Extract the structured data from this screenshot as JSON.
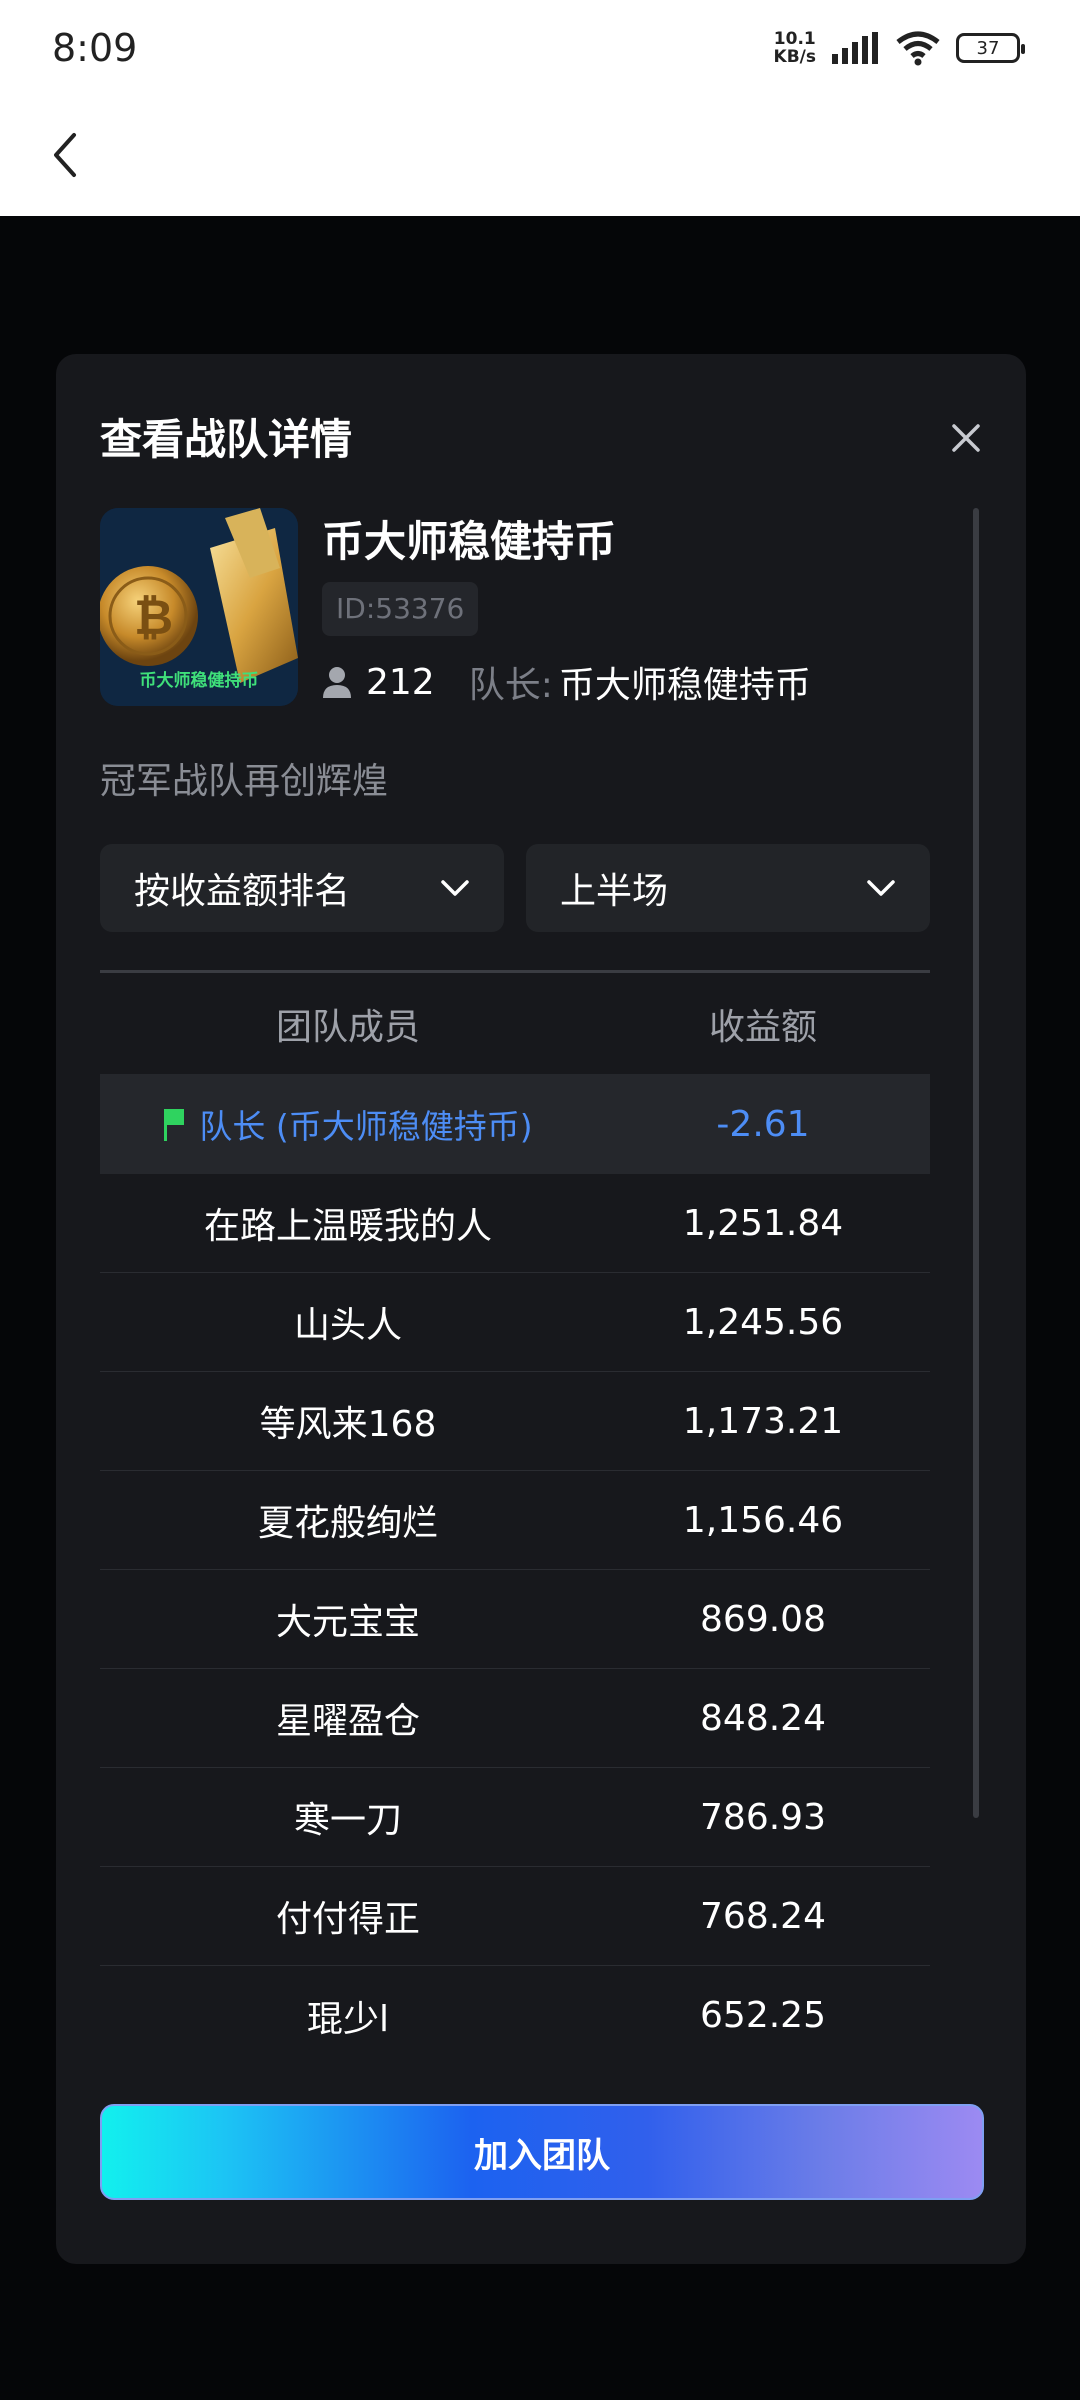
{
  "status_bar": {
    "time": "8:09",
    "net_speed_value": "10.1",
    "net_speed_unit": "KB/s",
    "battery": "37"
  },
  "modal": {
    "title": "查看战队详情",
    "team": {
      "name": "币大师稳健持币",
      "id": "ID:53376",
      "member_count": "212",
      "captain_label": "队长:",
      "captain_name": "币大师稳健持币",
      "slogan": "冠军战队再创辉煌",
      "logo_caption": "币大师稳健持币"
    },
    "filters": {
      "sort": "按收益额排名",
      "period": "上半场"
    },
    "table": {
      "headers": [
        "团队成员",
        "收益额"
      ],
      "captain_row": {
        "name": "队长 (币大师稳健持币)",
        "value": "-2.61"
      },
      "rows": [
        {
          "name": "在路上温暖我的人",
          "value": "1,251.84"
        },
        {
          "name": "山头人",
          "value": "1,245.56"
        },
        {
          "name": "等风来168",
          "value": "1,173.21"
        },
        {
          "name": "夏花般绚烂",
          "value": "1,156.46"
        },
        {
          "name": "大元宝宝",
          "value": "869.08"
        },
        {
          "name": "星曜盈仓",
          "value": "848.24"
        },
        {
          "name": "寒一刀",
          "value": "786.93"
        },
        {
          "name": "付付得正",
          "value": "768.24"
        },
        {
          "name": "琨少l",
          "value": "652.25"
        }
      ]
    },
    "join_button": "加入团队"
  },
  "colors": {
    "accent_blue": "#4d8df5",
    "flag_green": "#2fd35f",
    "modal_bg": "#17181c"
  },
  "icons": [
    "back-arrow-icon",
    "close-icon",
    "person-icon",
    "chevron-down-icon",
    "flag-icon",
    "signal-icon",
    "wifi-icon",
    "battery-icon"
  ]
}
